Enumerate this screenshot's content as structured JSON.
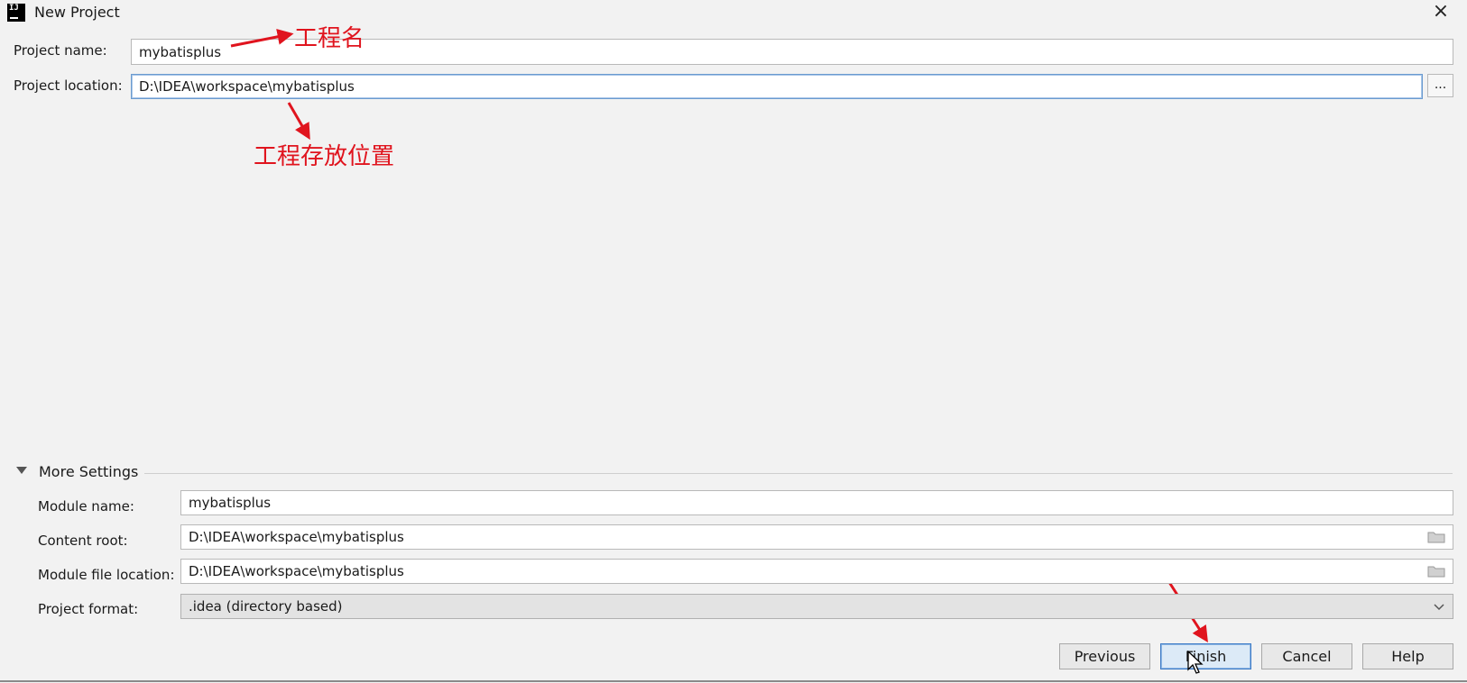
{
  "window": {
    "title": "New Project",
    "close_glyph": "×",
    "app_icon_text": "IJ"
  },
  "project": {
    "name_label": "Project name:",
    "name_value": "mybatisplus",
    "location_label": "Project location:",
    "location_value": "D:\\IDEA\\workspace\\mybatisplus",
    "browse_label": "..."
  },
  "annotations": {
    "project_name_note": "工程名",
    "project_location_note": "工程存放位置"
  },
  "more_settings": {
    "header": "More Settings",
    "module_name_label": "Module name:",
    "module_name_value": "mybatisplus",
    "content_root_label": "Content root:",
    "content_root_value": "D:\\IDEA\\workspace\\mybatisplus",
    "module_file_label": "Module file location:",
    "module_file_value": "D:\\IDEA\\workspace\\mybatisplus",
    "format_label": "Project format:",
    "format_value": ".idea (directory based)"
  },
  "buttons": {
    "previous": "Previous",
    "finish": "Finish",
    "cancel": "Cancel",
    "help": "Help"
  },
  "colors": {
    "annotation": "#e0141e",
    "focus_border": "#6b9bcf",
    "primary_button": "#dceaf7"
  },
  "icons": [
    "intellij-app-icon",
    "close-icon",
    "triangle-down-icon",
    "folder-icon",
    "chevron-down-icon",
    "arrow-icon"
  ]
}
